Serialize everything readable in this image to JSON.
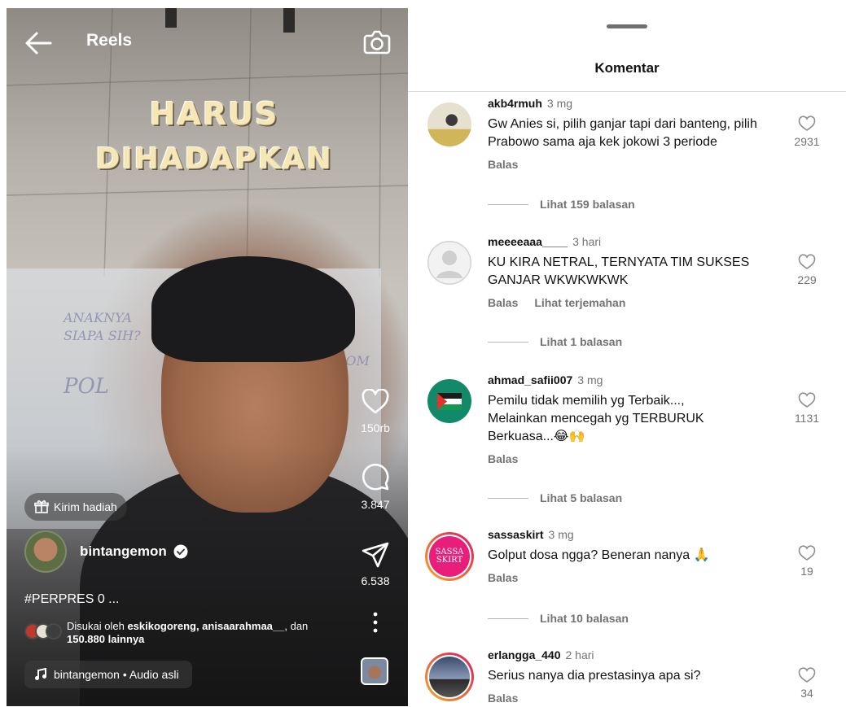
{
  "reel": {
    "header_title": "Reels",
    "overlay_line1": "HARUS",
    "overlay_line2": "DIHADAPKAN",
    "board_writing_1": "ANAKNYA",
    "board_writing_2": "SIAPA SIH?",
    "board_writing_3": "POL",
    "board_writing_4": "MOM",
    "like_count": "150rb",
    "comment_count": "3.847",
    "share_count": "6.538",
    "gift_label": "Kirim hadiah",
    "creator_name": "bintangemon",
    "caption": "#PERPRES 0 ...",
    "liked_by_prefix": "Disukai oleh ",
    "liked_by_users": "eskikogoreng, anisaarahmaa__",
    "liked_by_mid": ", dan",
    "liked_by_others": "150.880 lainnya",
    "audio_label": "bintangemon • Audio asli"
  },
  "comments_sheet": {
    "title": "Komentar",
    "reply_label": "Balas",
    "translate_label": "Lihat terjemahan",
    "comments": [
      {
        "user": "akb4rmuh",
        "time": "3 mg",
        "text": "Gw Anies si, pilih ganjar tapi dari banteng, pilih Prabowo sama aja kek jokowi 3 periode",
        "likes": "2931",
        "replies": "Lihat 159 balasan"
      },
      {
        "user": "meeeeaaa____",
        "time": "3 hari",
        "text": "KU KIRA NETRAL, TERNYATA TIM SUKSES GANJAR WKWKWKWK",
        "likes": "229",
        "replies": "Lihat 1 balasan"
      },
      {
        "user": "ahmad_safii007",
        "time": "3 mg",
        "text": "Pemilu tidak memilih yg Terbaik..., Melainkan mencegah yg TERBURUK Berkuasa...😂🙌",
        "likes": "1131",
        "replies": "Lihat 5 balasan"
      },
      {
        "user": "sassaskirt",
        "time": "3 mg",
        "text": "Golput dosa ngga? Beneran nanya 🙏",
        "likes": "19",
        "replies": "Lihat 10 balasan",
        "avatar_text_1": "SASSA",
        "avatar_text_2": "SKIRT"
      },
      {
        "user": "erlangga_440",
        "time": "2 hari",
        "text": "Serius nanya dia prestasinya apa si?",
        "likes": "34"
      }
    ]
  },
  "colors": {
    "sheet_bg": "#ffffff",
    "muted_text": "#737373",
    "story_ring_start": "#f9a825",
    "story_ring_end": "#d81b60",
    "palestine_green": "#149954",
    "palestine_red": "#e4312b"
  },
  "icons": {
    "back": "back-arrow-icon",
    "camera": "camera-icon",
    "like": "heart-icon",
    "comment": "comment-bubble-icon",
    "share": "paper-plane-icon",
    "more": "more-vertical-icon",
    "gift": "gift-icon",
    "music": "music-note-icon",
    "verified": "verified-badge-icon"
  }
}
